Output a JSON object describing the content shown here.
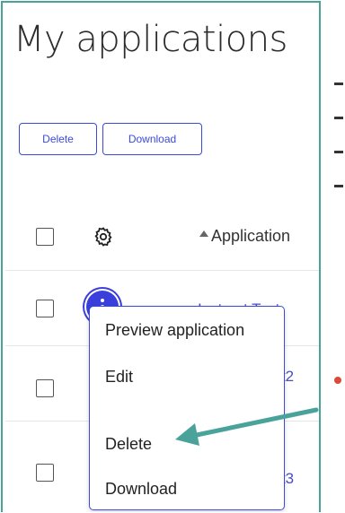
{
  "page": {
    "title": "My applications"
  },
  "toolbar": {
    "delete_label": "Delete",
    "download_label": "Download"
  },
  "table": {
    "settings_icon": "gear-icon",
    "column_header": "Application",
    "sort": "ascending",
    "rows": [
      {
        "name": "Instruct Test",
        "menu_open": true
      },
      {
        "name": "est2"
      },
      {
        "name": "est3"
      }
    ]
  },
  "menu": {
    "items": [
      {
        "label": "Preview application"
      },
      {
        "label": "Edit"
      },
      {
        "label": "Delete"
      },
      {
        "label": "Download"
      }
    ]
  },
  "colors": {
    "accent": "#3a3fdc",
    "frame": "#4aa39b",
    "annotation_arrow": "#4aa39b"
  }
}
